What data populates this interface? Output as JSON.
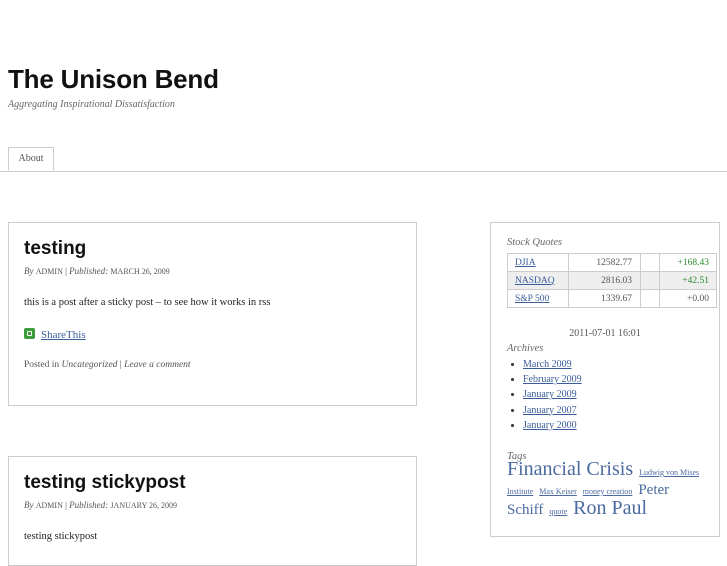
{
  "site": {
    "title": "The Unison Bend",
    "description": "Aggregating Inspirational Dissatisfaction"
  },
  "nav": {
    "items": [
      {
        "label": "About"
      }
    ]
  },
  "posts": [
    {
      "title": "testing",
      "by": "By",
      "author": "ADMIN",
      "sep": "|",
      "published_label": "Published:",
      "date": "MARCH 26, 2009",
      "body": "this is a post after a sticky post – to see how it works in rss",
      "share_label": "ShareThis",
      "posted_in": "Posted in",
      "category": "Uncategorized",
      "comment_link": "Leave a comment"
    },
    {
      "title": "testing stickypost",
      "by": "By",
      "author": "ADMIN",
      "sep": "|",
      "published_label": "Published:",
      "date": "JANUARY 26, 2009",
      "body": "testing stickypost"
    }
  ],
  "sidebar": {
    "stock_title": "Stock Quotes",
    "quotes": [
      {
        "symbol": "DJIA",
        "value": "12582.77",
        "change": "+168.43",
        "trend": "up"
      },
      {
        "symbol": "NASDAQ",
        "value": "2816.03",
        "change": "+42.51",
        "trend": "up"
      },
      {
        "symbol": "S&P 500",
        "value": "1339.67",
        "change": "+0.00",
        "trend": "flat"
      }
    ],
    "timestamp": "2011-07-01 16:01",
    "archives_title": "Archives",
    "archives": [
      "March 2009",
      "February 2009",
      "January 2009",
      "January 2007",
      "January 2000"
    ],
    "tags_title": "Tags",
    "tags": [
      {
        "label": "Financial Crisis",
        "size": "large"
      },
      {
        "label": "Ludwig von Mises Institute",
        "size": "small"
      },
      {
        "label": "Max Keiser",
        "size": "small"
      },
      {
        "label": "money creation",
        "size": "small"
      },
      {
        "label": "Peter Schiff",
        "size": "medium"
      },
      {
        "label": "quote",
        "size": "small"
      },
      {
        "label": "Ron Paul",
        "size": "large"
      }
    ]
  },
  "colors": {
    "link": "#3b5e9b",
    "gain": "#2a8a2a",
    "border": "#cccccc"
  }
}
